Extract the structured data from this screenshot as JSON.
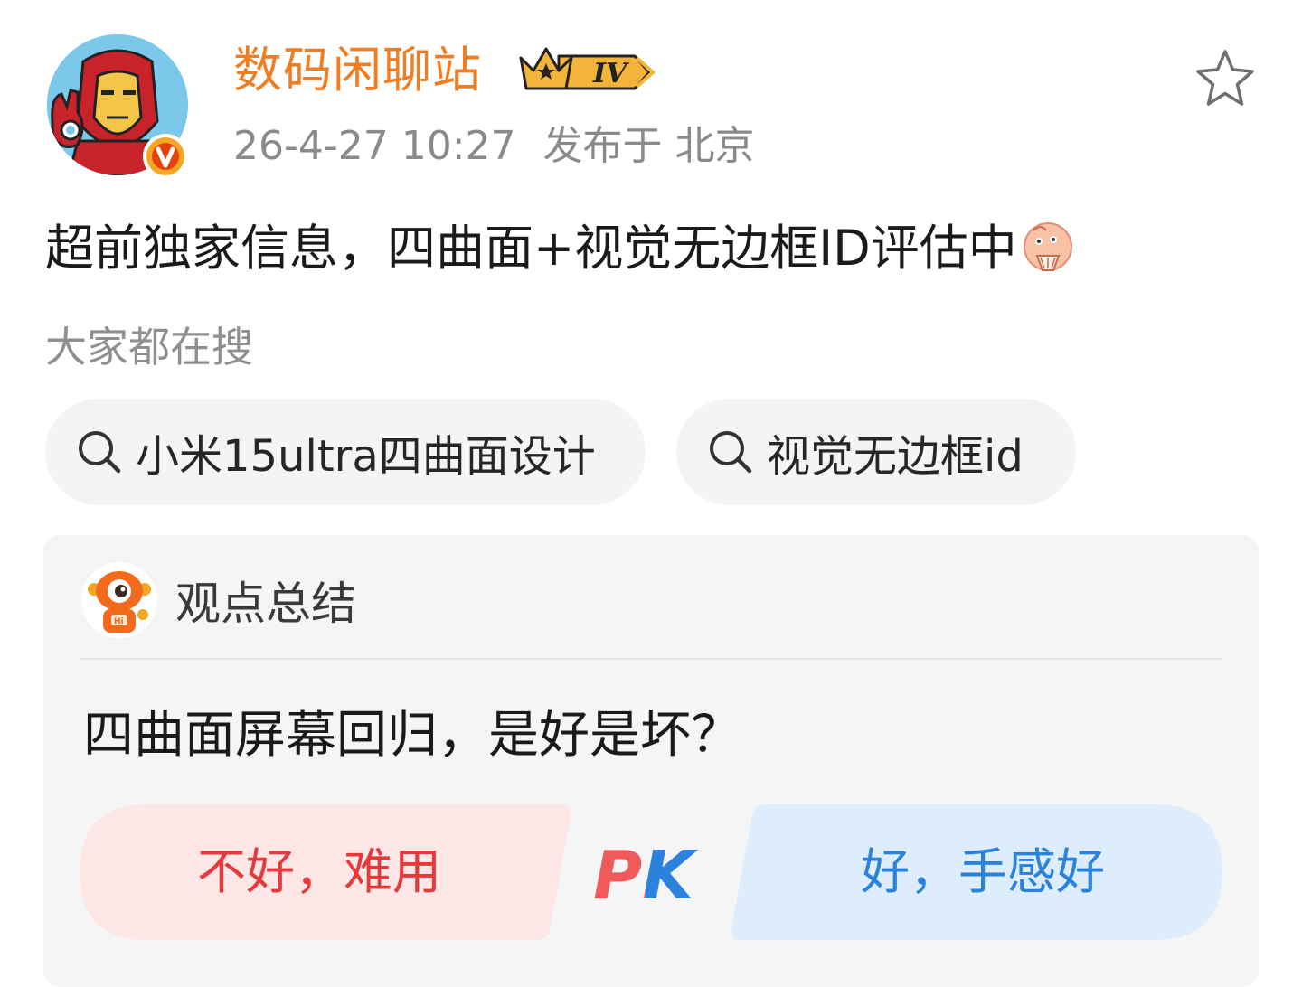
{
  "post": {
    "author": "数码闲聊站",
    "level_badge": "IV",
    "timestamp": "26-4-27 10:27",
    "location": "发布于 北京",
    "text": "超前独家信息，四曲面+视觉无边框ID评估中",
    "emoji_icon": "fan-face-emoji",
    "avatar_icon": "iron-man-avatar",
    "verified_icon": "verified-v-badge"
  },
  "search": {
    "label": "大家都在搜",
    "chips": [
      {
        "text": "小米15ultra四曲面设计",
        "icon": "search-icon"
      },
      {
        "text": "视觉无边框id",
        "icon": "search-icon"
      }
    ]
  },
  "summary": {
    "title": "观点总结",
    "question": "四曲面屏幕回归，是好是坏？",
    "options": {
      "left": "不好，难用",
      "vs": "PK",
      "right": "好，手感好"
    }
  },
  "colors": {
    "author": "#f07d22",
    "left_option_text": "#e5393c",
    "left_option_bg": "#fde6e6",
    "right_option_text": "#2b82dc",
    "right_option_bg": "#deedfb",
    "card_bg": "#f5f5f5"
  }
}
